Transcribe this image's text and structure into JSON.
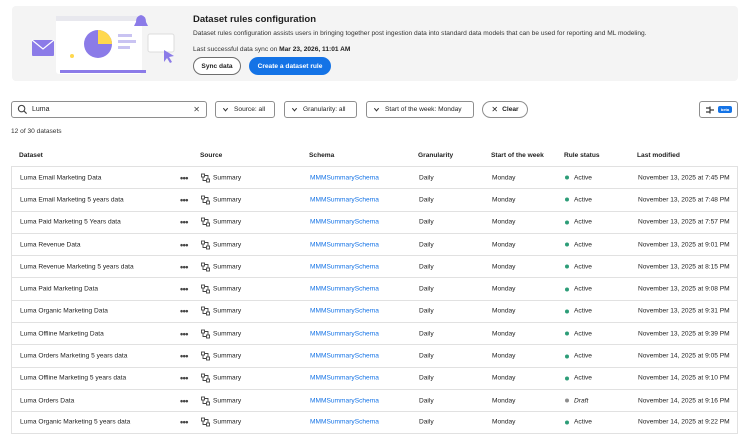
{
  "banner": {
    "title": "Dataset rules configuration",
    "description": "Dataset rules configuration assists users in bringing together post ingestion data into standard data models that can be used for reporting and ML modeling.",
    "sync_prefix": "Last successful data sync on ",
    "sync_time": "Mar 23, 2026, 11:01 AM",
    "sync_button": "Sync data",
    "create_button": "Create a dataset rule"
  },
  "toolbar": {
    "search_value": "Luma",
    "search_icon": "search-icon",
    "source_filter": "Source: all",
    "granularity_filter": "Granularity: all",
    "week_filter": "Start of the week: Monday",
    "clear_label": "Clear",
    "beta_label": "beta"
  },
  "count_text": "12 of 30 datasets",
  "columns": [
    "Dataset",
    "Source",
    "Schema",
    "Granularity",
    "Start of the week",
    "Rule status",
    "Last modified"
  ],
  "colors": {
    "accent": "#1473e6",
    "active": "#2d9d78",
    "draft": "#8e8e8e"
  },
  "rows": [
    {
      "dataset": "Luma Email Marketing Data",
      "more": "•••",
      "source": "Summary",
      "schema": "MMMSummarySchema",
      "granularity": "Daily",
      "week": "Monday",
      "status": "Active",
      "modified": "November 13, 2025 at 7:45 PM"
    },
    {
      "dataset": "Luma Email Marketing 5 years data",
      "more": "•••",
      "source": "Summary",
      "schema": "MMMSummarySchema",
      "granularity": "Daily",
      "week": "Monday",
      "status": "Active",
      "modified": "November 13, 2025 at 7:48 PM"
    },
    {
      "dataset": "Luma Paid Marketing 5 Years data",
      "more": "•••",
      "source": "Summary",
      "schema": "MMMSummarySchema",
      "granularity": "Daily",
      "week": "Monday",
      "status": "Active",
      "modified": "November 13, 2025 at 7:57 PM"
    },
    {
      "dataset": "Luma Revenue Data",
      "more": "•••",
      "source": "Summary",
      "schema": "MMMSummarySchema",
      "granularity": "Daily",
      "week": "Monday",
      "status": "Active",
      "modified": "November 13, 2025 at 9:01 PM"
    },
    {
      "dataset": "Luma Revenue Marketing 5 years data",
      "more": "•••",
      "source": "Summary",
      "schema": "MMMSummarySchema",
      "granularity": "Daily",
      "week": "Monday",
      "status": "Active",
      "modified": "November 13, 2025 at 8:15 PM"
    },
    {
      "dataset": "Luma Paid Marketing Data",
      "more": "•••",
      "source": "Summary",
      "schema": "MMMSummarySchema",
      "granularity": "Daily",
      "week": "Monday",
      "status": "Active",
      "modified": "November 13, 2025 at 9:08 PM"
    },
    {
      "dataset": "Luma Organic Marketing Data",
      "more": "•••",
      "source": "Summary",
      "schema": "MMMSummarySchema",
      "granularity": "Daily",
      "week": "Monday",
      "status": "Active",
      "modified": "November 13, 2025 at 9:31 PM"
    },
    {
      "dataset": "Luma Offline Marketing Data",
      "more": "•••",
      "source": "Summary",
      "schema": "MMMSummarySchema",
      "granularity": "Daily",
      "week": "Monday",
      "status": "Active",
      "modified": "November 13, 2025 at 9:39 PM"
    },
    {
      "dataset": "Luma Orders Marketing 5 years data",
      "more": "•••",
      "source": "Summary",
      "schema": "MMMSummarySchema",
      "granularity": "Daily",
      "week": "Monday",
      "status": "Active",
      "modified": "November 14, 2025 at 9:05 PM"
    },
    {
      "dataset": "Luma Offline Marketing 5 years data",
      "more": "•••",
      "source": "Summary",
      "schema": "MMMSummarySchema",
      "granularity": "Daily",
      "week": "Monday",
      "status": "Active",
      "modified": "November 14, 2025 at 9:10 PM"
    },
    {
      "dataset": "Luma Orders Data",
      "more": "•••",
      "source": "Summary",
      "schema": "MMMSummarySchema",
      "granularity": "Daily",
      "week": "Monday",
      "status": "Draft",
      "modified": "November 14, 2025 at 9:16 PM"
    },
    {
      "dataset": "Luma Organic Marketing 5 years data",
      "more": "•••",
      "source": "Summary",
      "schema": "MMMSummarySchema",
      "granularity": "Daily",
      "week": "Monday",
      "status": "Active",
      "modified": "November 14, 2025 at 9:22 PM"
    }
  ]
}
